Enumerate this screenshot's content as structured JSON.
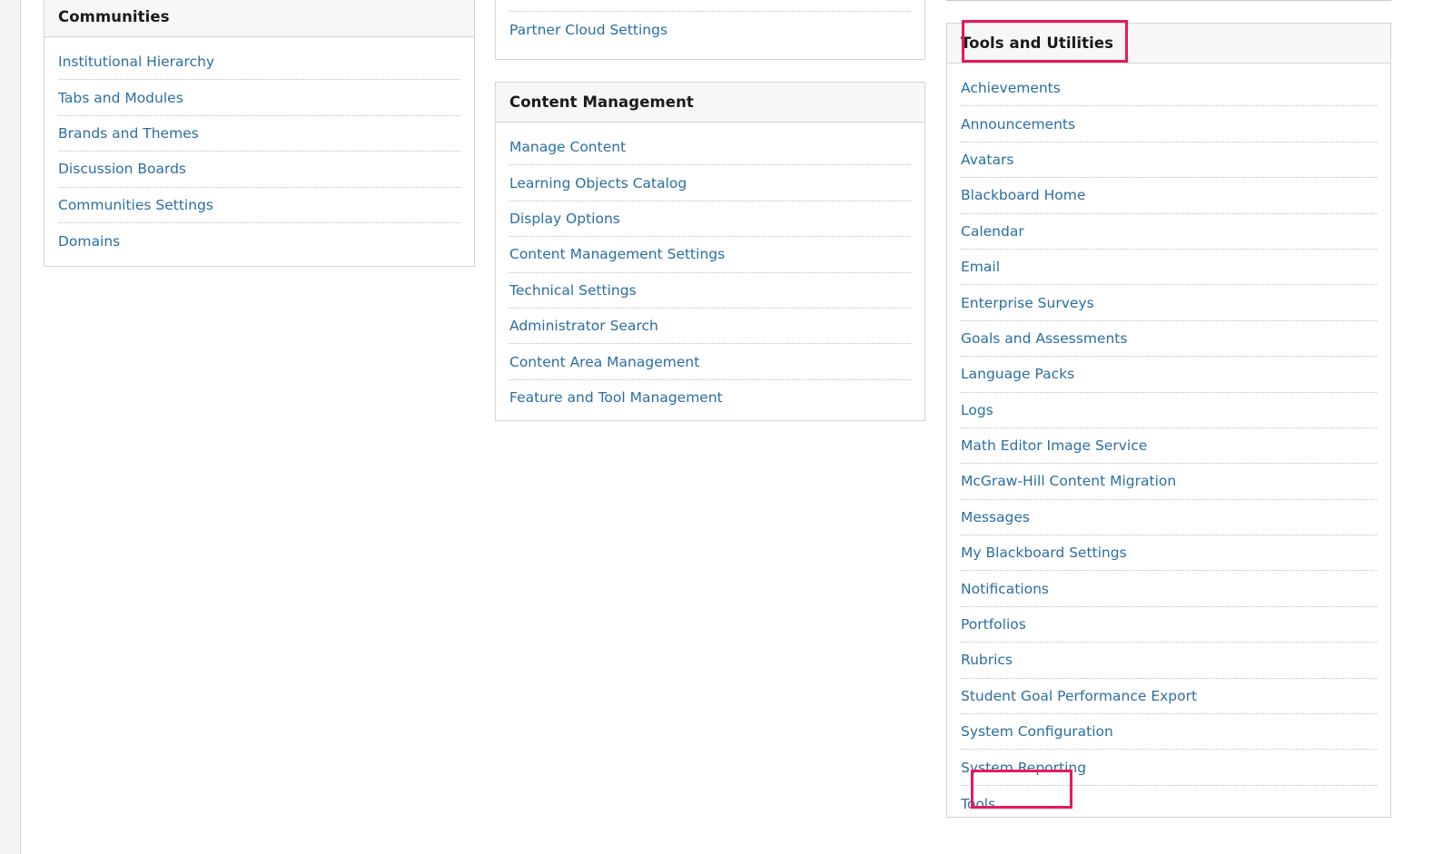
{
  "communities": {
    "title": "Communities",
    "items": [
      "Institutional Hierarchy",
      "Tabs and Modules",
      "Brands and Themes",
      "Discussion Boards",
      "Communities Settings",
      "Domains"
    ]
  },
  "cloud": {
    "items": [
      "Partner Cloud Settings"
    ]
  },
  "content_management": {
    "title": "Content Management",
    "items": [
      "Manage Content",
      "Learning Objects Catalog",
      "Display Options",
      "Content Management Settings",
      "Technical Settings",
      "Administrator Search",
      "Content Area Management",
      "Feature and Tool Management"
    ]
  },
  "tools_utilities": {
    "title": "Tools and Utilities",
    "items": [
      "Achievements",
      "Announcements",
      "Avatars",
      "Blackboard Home",
      "Calendar",
      "Email",
      "Enterprise Surveys",
      "Goals and Assessments",
      "Language Packs",
      "Logs",
      "Math Editor Image Service",
      "McGraw-Hill Content Migration",
      "Messages",
      "My Blackboard Settings",
      "Notifications",
      "Portfolios",
      "Rubrics",
      "Student Goal Performance Export",
      "System Configuration",
      "System Reporting",
      "Tools"
    ]
  },
  "colors": {
    "link": "#2a6ea3",
    "highlight": "#e8185c",
    "header_bg": "#f7f7f7",
    "border": "#d4d4d4"
  }
}
